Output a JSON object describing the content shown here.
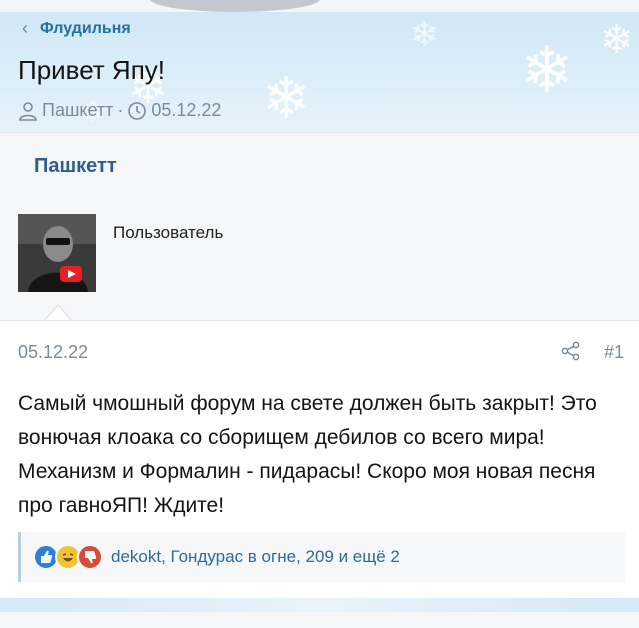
{
  "breadcrumb": {
    "back_icon": "chevron-left-icon",
    "label": "Флудильня"
  },
  "thread": {
    "title": "Привет Япу!",
    "author": "Пашкетт",
    "separator": "·",
    "date": "05.12.22"
  },
  "user": {
    "name": "Пашкетт",
    "title": "Пользователь",
    "avatar_icon": "avatar-photo"
  },
  "post": {
    "date": "05.12.22",
    "number": "#1",
    "body": "Самый чмошный форум на свете должен быть закрыт! Это вонючая клоака со сборищем дебилов со всего мира! Механизм и Формалин - пидарасы! Скоро моя новая песня про гавноЯП! Ждите!",
    "reactions_text": "dekokt, Гондурас в огне, 209 и ещё 2"
  },
  "colors": {
    "link": "#2470a8",
    "meta": "#7b8b98",
    "like": "#2f7fd8",
    "laugh": "#f1c232",
    "dislike": "#d84a3a"
  }
}
